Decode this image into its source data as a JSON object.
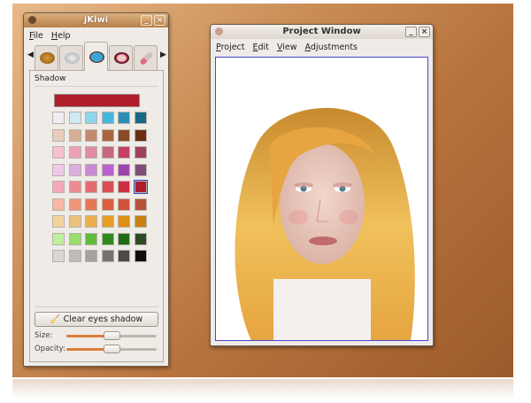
{
  "left_window": {
    "title": "jKiwi",
    "menu": [
      "File",
      "Help"
    ],
    "tabs": [
      "hair",
      "accessories",
      "eye-shadow",
      "blush",
      "lipstick"
    ],
    "active_tab": 2,
    "section": "Shadow",
    "selected_color": "#b01e2c",
    "swatches": [
      "#efedf3",
      "#cfeaf3",
      "#8fd6ea",
      "#45b6dc",
      "#2990b4",
      "#176a86",
      "#e8cdbd",
      "#d6ad96",
      "#c38a6c",
      "#a9653f",
      "#8a4a27",
      "#6b2e10",
      "#f6bfd0",
      "#eba1b6",
      "#e08da3",
      "#c9677f",
      "#c64160",
      "#a1405e",
      "#f0c8ea",
      "#ddaee0",
      "#c98ad3",
      "#b962cf",
      "#9d45ac",
      "#7f4e7c",
      "#f3a9b8",
      "#ee8a92",
      "#e56b72",
      "#da4d57",
      "#cc3042",
      "#b01e2c",
      "#f9b7a3",
      "#f19478",
      "#e77657",
      "#dc5f3e",
      "#cd5438",
      "#b6523a",
      "#f2d49a",
      "#ebc27e",
      "#ebb04c",
      "#e99e24",
      "#df8e16",
      "#c97f10",
      "#bdf09a",
      "#97de70",
      "#5fbb3a",
      "#2f8a1a",
      "#1f6a12",
      "#2d4a26",
      "#d9d7d4",
      "#bfbdba",
      "#a4a2a0",
      "#747372",
      "#4b4a49",
      "#0d0d0d"
    ],
    "selected_swatch": 29,
    "clear_button": "Clear eyes shadow",
    "size_label": "Size:",
    "opacity_label": "Opacity:",
    "size_value": 0.5,
    "opacity_value": 0.5
  },
  "project_window": {
    "title": "Project Window",
    "menu": [
      "Project",
      "Edit",
      "View",
      "Adjustments"
    ]
  },
  "controls": {
    "minimize": "_",
    "close": "×"
  }
}
